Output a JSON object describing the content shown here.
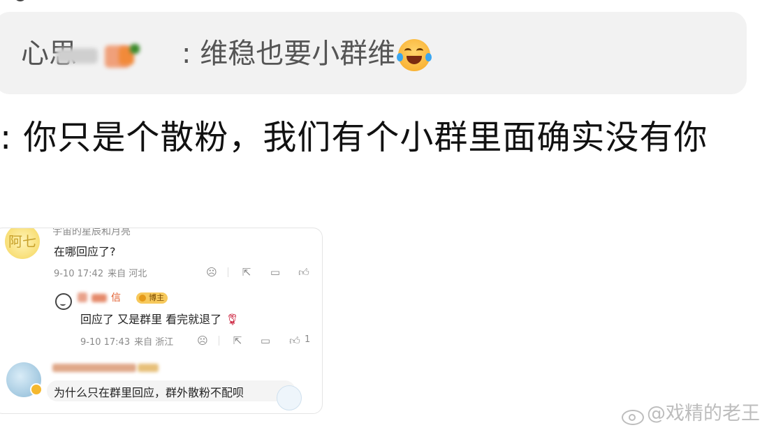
{
  "quote": {
    "name": "心思",
    "text": ": 维稳也要小群维"
  },
  "main": {
    "text": ": 你只是个散粉，我们有个小群里面确实没有你"
  },
  "card": {
    "top_name": "宇宙的星辰和月亮",
    "comment1": {
      "avatar_text": "阿七",
      "text": "在哪回应了?",
      "date": "9-10 17:42",
      "from": "来自 河北"
    },
    "reply": {
      "name_visible": "信",
      "badge": "博主",
      "text": "回应了 又是群里 看完就退了",
      "date": "9-10 17:43",
      "from": "来自 浙江",
      "like_count": "1"
    },
    "comment2": {
      "text": "为什么只在群里回应，群外散粉不配呗"
    }
  },
  "watermark": {
    "text": "@戏精的老王"
  },
  "colors": {
    "quote_bg": "#f2f2f2",
    "badge": "#f7c95c",
    "watermark": "#bdbdbd"
  },
  "icons": [
    "laugh-tears-emoji",
    "dislike-icon",
    "share-icon",
    "comment-icon",
    "like-icon",
    "rose-emoji",
    "weibo-logo-icon"
  ]
}
